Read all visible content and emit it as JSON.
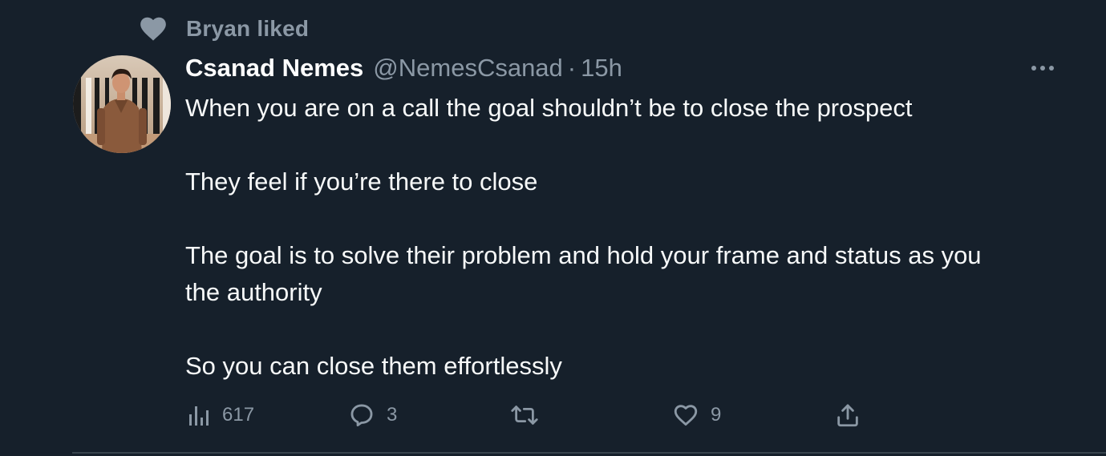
{
  "social_context": {
    "text": "Bryan liked",
    "icon": "heart-icon"
  },
  "author": {
    "display_name": "Csanad Nemes",
    "handle": "@NemesCsanad",
    "separator": "·",
    "time": "15h"
  },
  "body": {
    "paragraphs": [
      [
        "When you are on a call the goal shouldn’t be to close the prospect"
      ],
      [
        "They feel if you’re there to close"
      ],
      [
        "The goal is to solve their problem and hold your frame and status as you",
        "the authority"
      ],
      [
        "So you can close them effortlessly"
      ]
    ]
  },
  "actions": {
    "views": {
      "icon": "analytics-icon",
      "count": "617"
    },
    "replies": {
      "icon": "reply-icon",
      "count": "3"
    },
    "retweets": {
      "icon": "retweet-icon",
      "count": ""
    },
    "likes": {
      "icon": "heart-outline-icon",
      "count": "9"
    },
    "share": {
      "icon": "share-icon"
    }
  },
  "colors": {
    "background": "#16202b",
    "primary_text": "#f7f9f9",
    "secondary_text": "#8b98a5",
    "divider": "#38444d"
  }
}
